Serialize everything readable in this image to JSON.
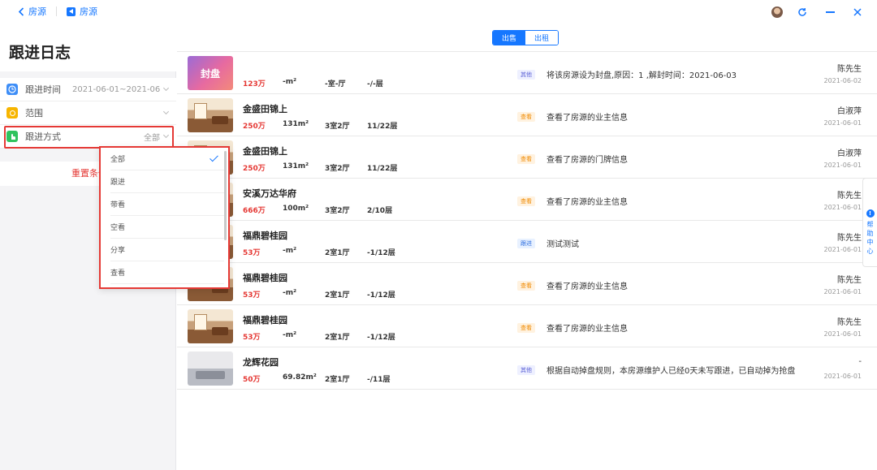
{
  "nav": {
    "back_label": "房源",
    "crumb_label": "房源"
  },
  "page": {
    "title": "跟进日志"
  },
  "filters": [
    {
      "label": "跟进时间",
      "value": "2021-06-01~2021-06...",
      "icon": "clock-icon",
      "color": "#3e8ef7"
    },
    {
      "label": "范围",
      "value": "",
      "icon": "scope-icon",
      "color": "#f7b500"
    },
    {
      "label": "跟进方式",
      "value": "全部",
      "icon": "hand-icon",
      "color": "#30c35e"
    }
  ],
  "reset_label": "重置条件",
  "dropdown": {
    "selected": "全部",
    "options": [
      "全部",
      "跟进",
      "带看",
      "空看",
      "分享",
      "查看"
    ]
  },
  "tabs": {
    "sale": "出售",
    "rent": "出租",
    "active": "出售"
  },
  "records": [
    {
      "name": "",
      "thumb_text": "封盘",
      "price": "123万",
      "area": "-m²",
      "layout": "-室-厅",
      "floor": "-/-层",
      "tag": "其他",
      "tag_type": "other",
      "desc": "将该房源设为封盘,原因：1 ,解封时间：2021-06-03",
      "person": "陈先生",
      "date": "2021-06-02"
    },
    {
      "name": "金盛田锦上",
      "thumb_text": "",
      "price": "250万",
      "area": "131m²",
      "layout": "3室2厅",
      "floor": "11/22层",
      "tag": "查看",
      "tag_type": "view",
      "desc": "查看了房源的业主信息",
      "person": "白淑萍",
      "date": "2021-06-01"
    },
    {
      "name": "金盛田锦上",
      "thumb_text": "",
      "price": "250万",
      "area": "131m²",
      "layout": "3室2厅",
      "floor": "11/22层",
      "tag": "查看",
      "tag_type": "view",
      "desc": "查看了房源的门牌信息",
      "person": "白淑萍",
      "date": "2021-06-01"
    },
    {
      "name": "安溪万达华府",
      "thumb_text": "",
      "price": "666万",
      "area": "100m²",
      "layout": "3室2厅",
      "floor": "2/10层",
      "tag": "查看",
      "tag_type": "view",
      "desc": "查看了房源的业主信息",
      "person": "陈先生",
      "date": "2021-06-01"
    },
    {
      "name": "福鼎碧桂园",
      "thumb_text": "",
      "price": "53万",
      "area": "-m²",
      "layout": "2室1厅",
      "floor": "-1/12层",
      "tag": "跟进",
      "tag_type": "follow",
      "desc": "测试测试",
      "person": "陈先生",
      "date": "2021-06-01"
    },
    {
      "name": "福鼎碧桂园",
      "thumb_text": "",
      "price": "53万",
      "area": "-m²",
      "layout": "2室1厅",
      "floor": "-1/12层",
      "tag": "查看",
      "tag_type": "view",
      "desc": "查看了房源的业主信息",
      "person": "陈先生",
      "date": "2021-06-01"
    },
    {
      "name": "福鼎碧桂园",
      "thumb_text": "",
      "price": "53万",
      "area": "-m²",
      "layout": "2室1厅",
      "floor": "-1/12层",
      "tag": "查看",
      "tag_type": "view",
      "desc": "查看了房源的业主信息",
      "person": "陈先生",
      "date": "2021-06-01"
    },
    {
      "name": "龙辉花园",
      "thumb_text": "",
      "price": "50万",
      "area": "69.82m²",
      "layout": "2室1厅",
      "floor": "-/11层",
      "tag": "其他",
      "tag_type": "other",
      "desc": "根据自动掉盘规则，本房源维护人已经0天未写跟进，已自动掉为抢盘",
      "person": "-",
      "date": "2021-06-01"
    }
  ],
  "help": {
    "label": "帮助中心",
    "icon": "info-icon"
  },
  "window": {
    "refresh_icon": "refresh-icon",
    "minimize_icon": "minimize-icon",
    "close_icon": "close-icon"
  }
}
